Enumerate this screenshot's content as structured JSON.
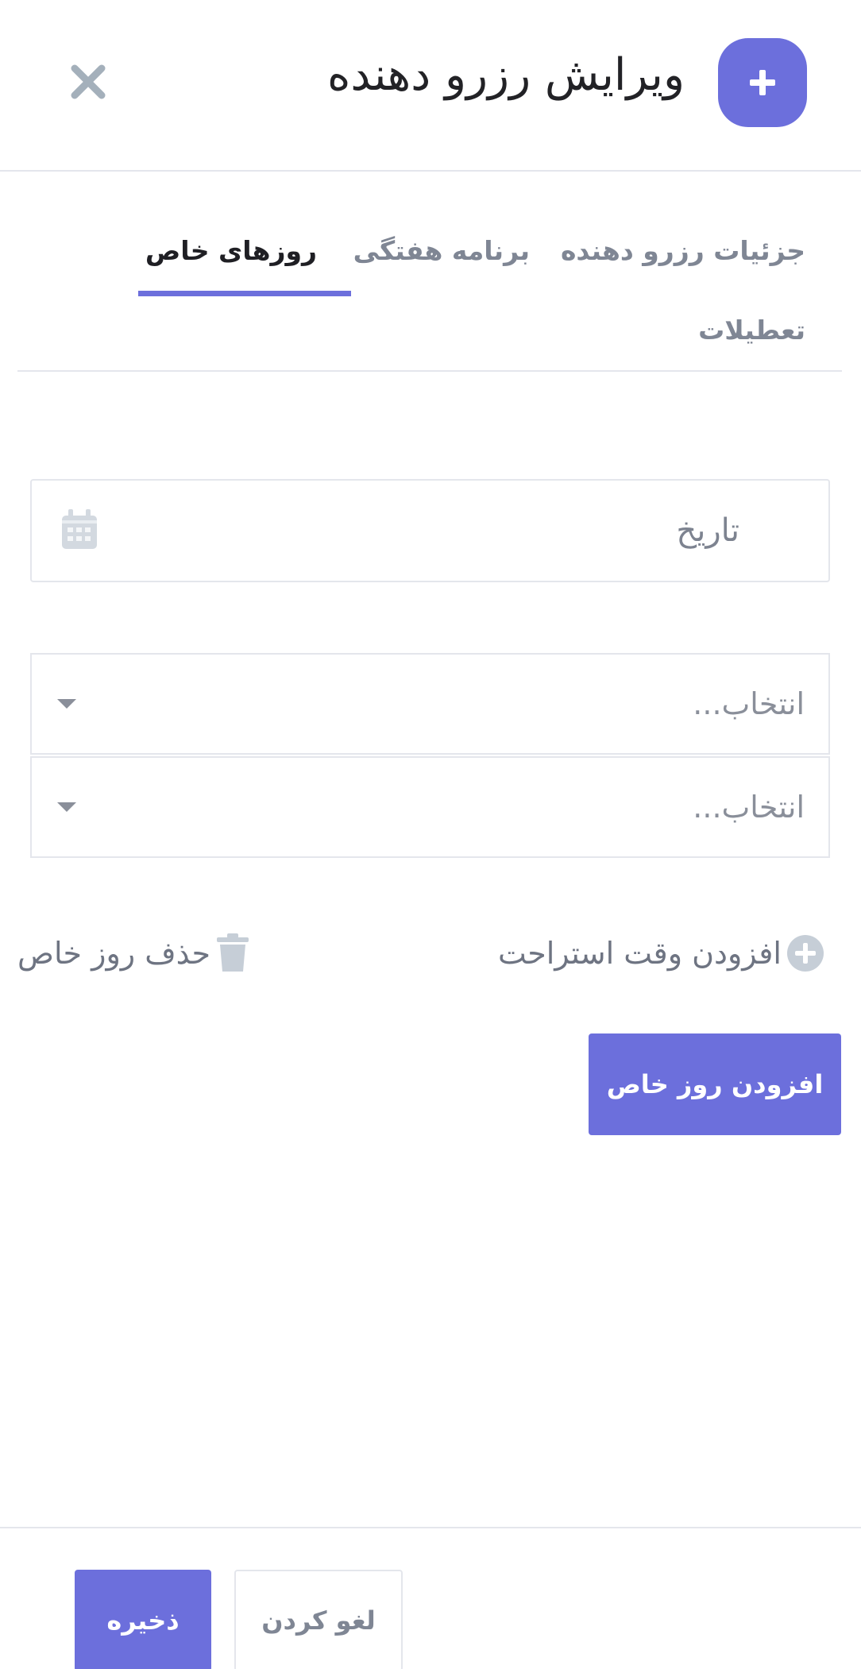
{
  "header": {
    "title": "ویرایش رزرو دهنده",
    "badge_icon": "plus-icon",
    "close_icon": "close-icon",
    "accent": "#6c6fdc"
  },
  "tabs": [
    {
      "label": "جزئیات رزرو دهنده",
      "active": false
    },
    {
      "label": "برنامه هفتگی",
      "active": false
    },
    {
      "label": "روزهای خاص",
      "active": true
    },
    {
      "label": "تعطیلات",
      "active": false
    }
  ],
  "form": {
    "date_placeholder": "تاریخ",
    "date_icon": "calendar-icon",
    "select_1_placeholder": "انتخاب...",
    "select_2_placeholder": "انتخاب..."
  },
  "actions": {
    "add_break_label": "افزودن وقت استراحت",
    "add_break_icon": "plus-circle-icon",
    "delete_day_label": "حذف روز خاص",
    "delete_day_icon": "trash-icon",
    "add_special_day_label": "افزودن روز خاص"
  },
  "footer": {
    "cancel_label": "لغو کردن",
    "save_label": "ذخیره"
  }
}
